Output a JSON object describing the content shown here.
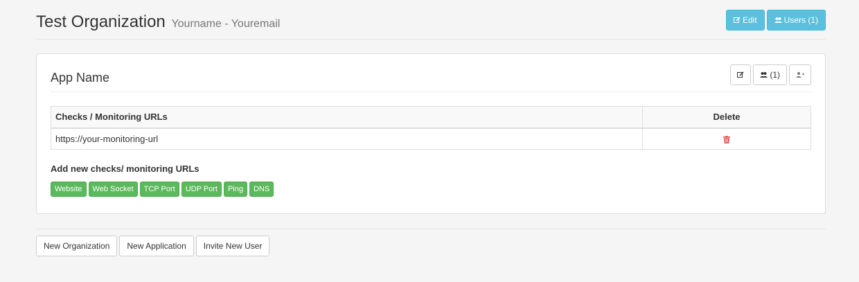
{
  "organization": {
    "name": "Test Organization",
    "owner": "Yourname - Youremail",
    "edit_label": "Edit",
    "users_label": "Users (1)"
  },
  "app": {
    "name": "App Name",
    "users_count_label": "(1)",
    "table": {
      "headers": [
        "Checks / Monitoring URLs",
        "Delete"
      ],
      "rows": [
        {
          "url": "https://your-monitoring-url"
        }
      ]
    },
    "add_title": "Add new checks/ monitoring URLs",
    "check_types": [
      "Website",
      "Web Socket",
      "TCP Port",
      "UDP Port",
      "Ping",
      "DNS"
    ]
  },
  "footer": {
    "buttons": [
      "New Organization",
      "New Application",
      "Invite New User"
    ]
  },
  "colors": {
    "info": "#5bc0de",
    "success": "#5cb85c",
    "danger": "#d9534f"
  },
  "icons": [
    "edit-icon",
    "users-icon",
    "add-user-icon",
    "trash-icon"
  ]
}
